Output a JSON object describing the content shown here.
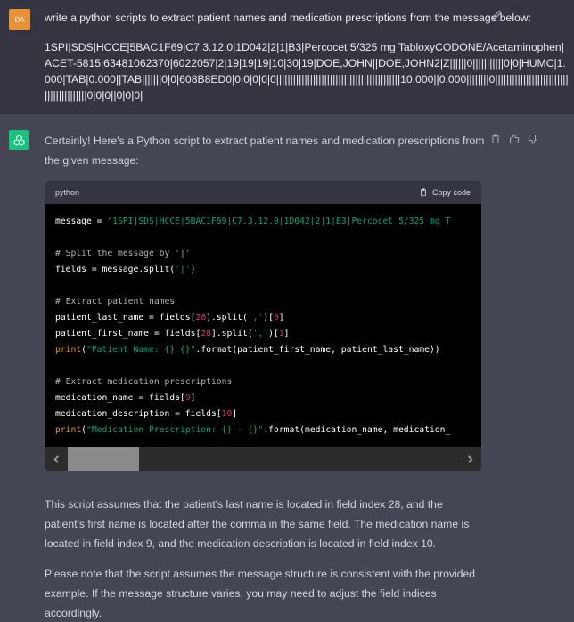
{
  "user": {
    "avatar_initials": "DA",
    "prompt": "write a python scripts to extract patient names and medication prescriptions from the message below:",
    "message": "1SPI|SDS|HCCE|5BAC1F69|C7.3.12.0|1D042|2|1|B3|Percocet 5/325 mg TabloxyCODONE/Acetaminophen|ACET-5815|63481062370|6022057|2|19|19|19|10|30|19|DOE,JOHN||DOE,JOHN2|Z||||||0|||||||||||0|0|HUMC|1.000|TAB|0.000||TAB|||||||0|0|608B8ED0|0|0|0|0|0||||||||||||||||||||||||||||||||||||||||||||10.000||0.000||||||||0|||||||||||||||||||||||||||||||||||||||||0|0|0||0|0|0|"
  },
  "assistant": {
    "intro": "Certainly! Here's a Python script to extract patient names and medication prescriptions from the given message:",
    "code_lang": "python",
    "copy_label": "Copy code",
    "para1": "This script assumes that the patient's last name is located in field index 28, and the patient's first name is located after the comma in the same field. The medication name is located in field index 9, and the medication description is located in field index 10.",
    "para2": "Please note that the script assumes the message structure is consistent with the provided example. If the message structure varies, you may need to adjust the field indices accordingly."
  },
  "code": {
    "l1_a": "message = ",
    "l1_b": "\"1SPI|SDS|HCCE|5BAC1F69|C7.3.12.0|1D042|2|1|B3|Percocet 5/325 mg T",
    "l3": "# Split the message by '|'",
    "l4_a": "fields = message.split(",
    "l4_b": "'|'",
    "l4_c": ")",
    "l6": "# Extract patient names",
    "l7_a": "patient_last_name = fields[",
    "l7_b": "28",
    "l7_c": "].split(",
    "l7_d": "','",
    "l7_e": ")[",
    "l7_f": "0",
    "l7_g": "]",
    "l8_a": "patient_first_name = fields[",
    "l8_b": "28",
    "l8_c": "].split(",
    "l8_d": "','",
    "l8_e": ")[",
    "l8_f": "1",
    "l8_g": "]",
    "l9_a": "print",
    "l9_b": "(",
    "l9_c": "\"Patient Name: {} {}\"",
    "l9_d": ".format(patient_first_name, patient_last_name))",
    "l11": "# Extract medication prescriptions",
    "l12_a": "medication_name = fields[",
    "l12_b": "9",
    "l12_c": "]",
    "l13_a": "medication_description = fields[",
    "l13_b": "10",
    "l13_c": "]",
    "l14_a": "print",
    "l14_b": "(",
    "l14_c": "\"Medication Prescription: {} - {}\"",
    "l14_d": ".format(medication_name, medication_"
  },
  "icons": {
    "edit": "edit-icon",
    "clipboard": "clipboard-icon",
    "thumbs_up": "thumbs-up-icon",
    "thumbs_down": "thumbs-down-icon",
    "copy": "copy-icon",
    "openai": "openai-logo-icon",
    "scroll_left": "chevron-left-icon",
    "scroll_right": "chevron-right-icon"
  },
  "colors": {
    "user_bg": "#343541",
    "assistant_bg": "#444654",
    "user_avatar": "#e8903a",
    "ai_avatar": "#19c37d",
    "code_bg": "#000000",
    "code_header": "#343541"
  }
}
